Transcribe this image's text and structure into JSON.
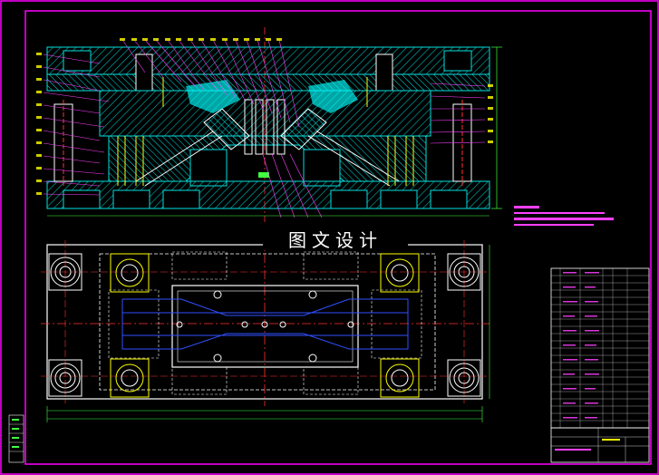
{
  "drawing": {
    "watermark_title": "图文设计",
    "colors": {
      "background": "#000000",
      "frame": "#ff00ff",
      "hatch": "#00c8c8",
      "centerline": "#ff3030",
      "part_yellow": "#ffff00",
      "part_white": "#ffffff",
      "part_blue": "#3050ff",
      "part_green": "#40ff40",
      "text_magenta": "#ff40ff"
    },
    "icons": [
      "bolt-circle-icon",
      "guide-pillar-icon",
      "centerline-cross-icon"
    ]
  }
}
